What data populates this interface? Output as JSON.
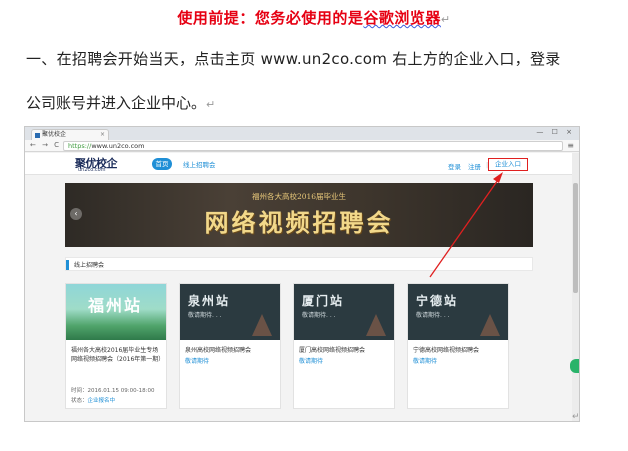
{
  "doc": {
    "title_pre": "使用前提：您务必使用的是",
    "title_underlined": "谷歌浏览器",
    "title_mark": "↵",
    "line1": "一、在招聘会开始当天，点击主页 www.un2co.com 右上方的企业入口，登录",
    "line2": "公司账号并进入企业中心。",
    "line2_mark": "↵",
    "corner_mark": "↵"
  },
  "browser": {
    "tab_title": "聚优校企",
    "tab_close": "×",
    "window_controls": "— ☐ ×",
    "nav_buttons": "← → C",
    "url_protocol": "https://",
    "url_host": "www.un2co.com",
    "menu_icon": "≡"
  },
  "site": {
    "logo": "聚优校企",
    "logo_sub": "un2co.com",
    "nav_home": "首页",
    "nav_online": "线上招聘会",
    "login": "登录",
    "register": "注册",
    "separator": "|",
    "enterprise_entry": "企业入口"
  },
  "banner": {
    "subtitle": "福州各大高校2016届毕业生",
    "title": "网络视频招聘会",
    "prev_arrow": "‹"
  },
  "section": {
    "label": "线上招聘会"
  },
  "cards": [
    {
      "image_text": "福州站",
      "title": "福州各大高校2016届毕业生专场网络视频招聘会（2016年第一期）",
      "time_label": "时间：",
      "time": "2016.01.15 09:00-18:00",
      "status_label": "状态：",
      "status": "企业报名中"
    },
    {
      "image_text": "泉州站",
      "image_sub": "敬请期待. . .",
      "title": "泉州高校网络视频招聘会",
      "link": "敬请期待"
    },
    {
      "image_text": "厦门站",
      "image_sub": "敬请期待. . .",
      "title": "厦门高校网络视频招聘会",
      "link": "敬请期待"
    },
    {
      "image_text": "宁德站",
      "image_sub": "敬请期待. . .",
      "title": "宁德高校网络视频招聘会",
      "link": "敬请期待"
    }
  ],
  "colors": {
    "title_red": "#e60012",
    "site_blue": "#1f8fd6",
    "highlight_red": "#e02020",
    "banner_gold": "#f2d88a"
  }
}
